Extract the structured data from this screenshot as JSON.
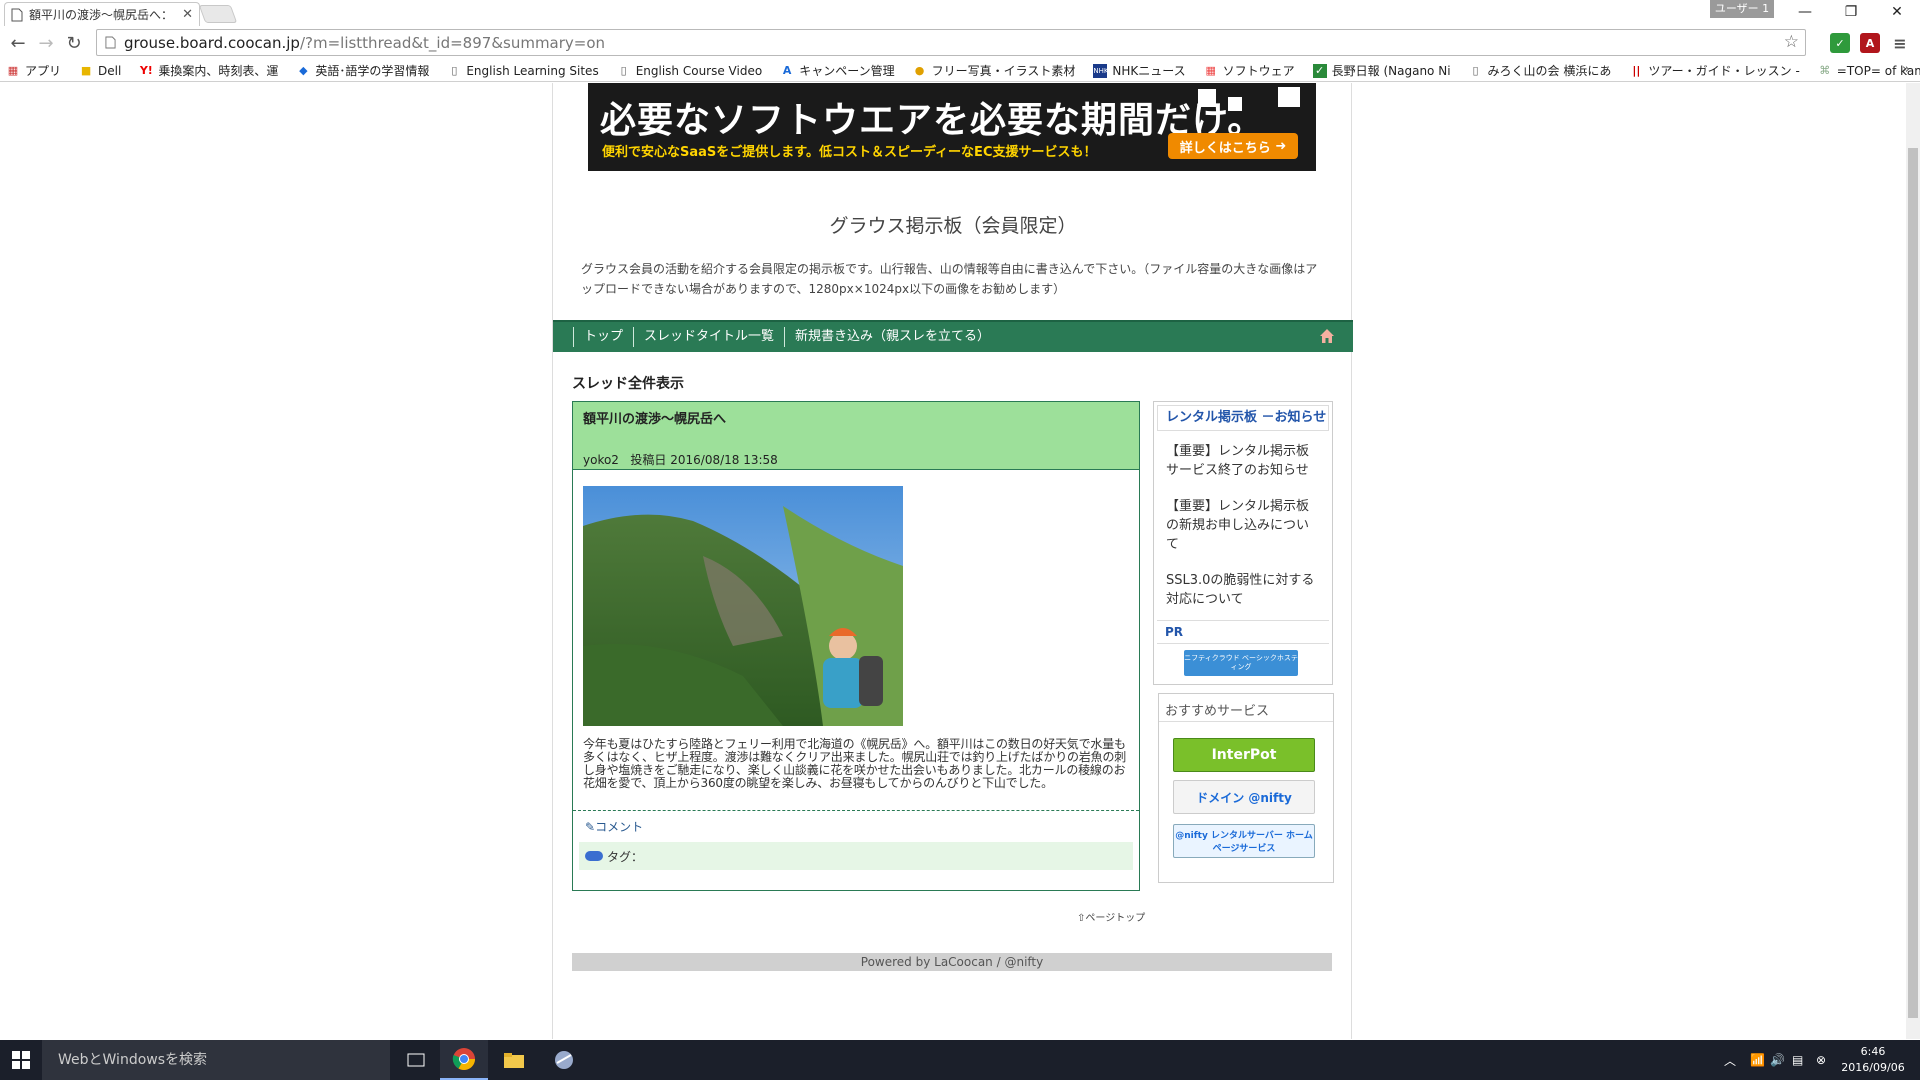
{
  "browser": {
    "tab_title": "額平川の渡渉～幌尻岳へ：",
    "user_badge": "ユーザー 1",
    "url_host": "grouse.board.coocan.jp",
    "url_path": "/?m=listthread&t_id=897&summary=on",
    "bookmarks": [
      {
        "label": "アプリ",
        "icon": "apps-grid-icon"
      },
      {
        "label": "Dell",
        "icon": "folder-icon"
      },
      {
        "label": "乗換案内、時刻表、運",
        "icon": "yahoo-icon"
      },
      {
        "label": "英語･語学の学習情報",
        "icon": "bookmark-site-icon"
      },
      {
        "label": "English Learning Sites",
        "icon": "page-icon"
      },
      {
        "label": "English Course Video",
        "icon": "page-icon"
      },
      {
        "label": "キャンペーン管理",
        "icon": "adwords-icon"
      },
      {
        "label": "フリー写真・イラスト素材",
        "icon": "photo-site-icon"
      },
      {
        "label": "NHKニュース",
        "icon": "nhk-icon"
      },
      {
        "label": "ソフトウェア",
        "icon": "windows-logo-icon"
      },
      {
        "label": "長野日報 (Nagano Ni",
        "icon": "bookmark-site-icon"
      },
      {
        "label": "みろく山の会 横浜にあ",
        "icon": "page-icon"
      },
      {
        "label": "ツアー・ガイド・レッスン - ",
        "icon": "bookmark-site-icon"
      },
      {
        "label": "=TOP= of kamoshika",
        "icon": "bookmark-site-icon"
      }
    ],
    "bookmarks_more": "»"
  },
  "page": {
    "banner": {
      "headline": "必要なソフトウエアを必要な期間だけ。",
      "subline": "便利で安心なSaaSをご提供します。低コスト＆スピーディーなEC支援サービスも！",
      "cta": "詳しくはこちら"
    },
    "board_title": "グラウス掲示板（会員限定）",
    "board_description": "グラウス会員の活動を紹介する会員限定の掲示板です。山行報告、山の情報等自由に書き込んで下さい。（ファイル容量の大きな画像はアップロードできない場合がありますので、1280px×1024px以下の画像をお勧めします）",
    "nav": [
      "トップ",
      "スレッドタイトル一覧",
      "新規書き込み（親スレを立てる）"
    ],
    "section_title": "スレッド全件表示",
    "thread": {
      "title": "額平川の渡渉～幌尻岳へ",
      "author": "yoko2",
      "posted_label": "投稿日",
      "posted_date": "2016/08/18 13:58",
      "body": "今年も夏はひたすら陸路とフェリー利用で北海道の《幌尻岳》へ。額平川はこの数日の好天気で水量も多くはなく、ヒザ上程度。渡渉は難なくクリア出来ました。幌尻山荘では釣り上げたばかりの岩魚の刺し身や塩焼きをご馳走になり、楽しく山談義に花を咲かせた出会いもありました。北カールの稜線のお花畑を愛で、頂上から360度の眺望を楽しみ、お昼寝もしてからのんびりと下山でした。",
      "comment_link": "コメント",
      "tag_label": "タグ："
    },
    "sidebar_notice": {
      "title": "レンタル掲示板 －お知らせ",
      "items": [
        "【重要】レンタル掲示板サービス終了のお知らせ",
        "【重要】レンタル掲示板の新規お申し込みについて",
        "SSL3.0の脆弱性に対する対応について"
      ],
      "pr_label": "PR",
      "pr_banner": "ニフティクラウド ベーシックホスティング"
    },
    "sidebar_recommend": {
      "title": "おすすめサービス",
      "ads": [
        "InterPot",
        "ドメイン @nifty",
        "@nifty レンタルサーバー ホームページサービス"
      ]
    },
    "page_top": "ページトップ",
    "footer": "Powered by LaCoocan / @nifty"
  },
  "taskbar": {
    "search_placeholder": "WebとWindowsを検索",
    "time": "6:46",
    "date": "2016/09/06"
  },
  "colors": {
    "nav_green": "#2a7a55",
    "thread_header_green": "#9de09a",
    "link_blue": "#2255aa",
    "banner_accent": "#f08a00"
  }
}
